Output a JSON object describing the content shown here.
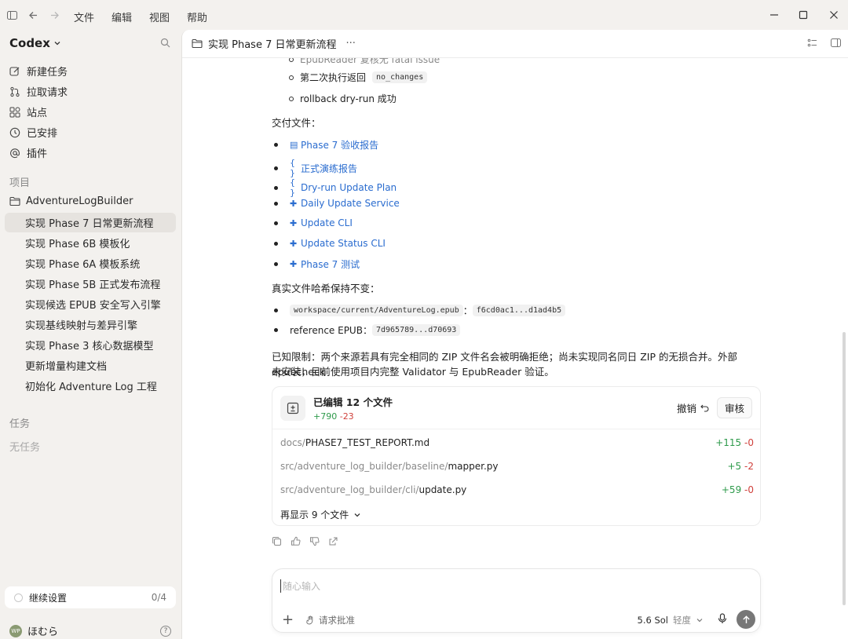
{
  "menu": {
    "items": [
      "文件",
      "编辑",
      "视图",
      "帮助"
    ]
  },
  "sidebar": {
    "brand": "Codex",
    "nav": [
      {
        "label": "新建任务",
        "icon": "edit-icon"
      },
      {
        "label": "拉取请求",
        "icon": "pull-request-icon"
      },
      {
        "label": "站点",
        "icon": "grid-icon"
      },
      {
        "label": "已安排",
        "icon": "clock-icon"
      },
      {
        "label": "插件",
        "icon": "at-icon"
      }
    ],
    "projects_label": "项目",
    "project_name": "AdventureLogBuilder",
    "threads": [
      "实现 Phase 7 日常更新流程",
      "实现 Phase 6B 模板化",
      "实现 Phase 6A 模板系统",
      "实现 Phase 5B 正式发布流程",
      "实现候选 EPUB 安全写入引擎",
      "实现基线映射与差异引擎",
      "实现 Phase 3 核心数据模型",
      "更新增量构建文档",
      "初始化 Adventure Log 工程"
    ],
    "tasks_label": "任务",
    "no_tasks": "无任务",
    "continue_label": "继续设置",
    "continue_count": "0/4",
    "user_name": "ほむら",
    "avatar_text": "WP"
  },
  "header": {
    "title": "实现 Phase 7 日常更新流程",
    "more": "···"
  },
  "content": {
    "partial_line": "EpubReader 复核无 fatal issue",
    "sub_bullets": [
      {
        "text": "第二次执行返回",
        "code": "no_changes"
      },
      {
        "text": "rollback dry-run 成功",
        "code": ""
      }
    ],
    "deliverables_label": "交付文件：",
    "links": [
      {
        "icon": "document-icon",
        "glyph": "▤",
        "label": "Phase 7 验收报告"
      },
      {
        "icon": "braces-icon",
        "glyph": "{ }",
        "label": "正式演练报告"
      },
      {
        "icon": "braces-icon",
        "glyph": "{ }",
        "label": "Dry-run Update Plan"
      },
      {
        "icon": "python-icon",
        "glyph": "✚",
        "label": "Daily Update Service"
      },
      {
        "icon": "python-icon",
        "glyph": "✚",
        "label": "Update CLI"
      },
      {
        "icon": "python-icon",
        "glyph": "✚",
        "label": "Update Status CLI"
      },
      {
        "icon": "python-icon",
        "glyph": "✚",
        "label": "Phase 7 测试"
      }
    ],
    "hash_label": "真实文件哈希保持不变：",
    "hashes": [
      {
        "left_code": "workspace/current/AdventureLog.epub",
        "sep": "：",
        "right_code": "f6cd0ac1...d1ad4b5"
      },
      {
        "left_text": "reference EPUB",
        "sep": "：",
        "right_code": "7d965789...d70693"
      }
    ],
    "limitation_line1": "已知限制：两个来源若具有完全相同的 ZIP 文件名会被明确拒绝；尚未实现同名同日 ZIP 的无损合并。外部 epubcheck",
    "limitation_line2": "未安装，目前使用项目内完整 Validator 与 EpubReader 验证。"
  },
  "edits": {
    "title": "已编辑 12 个文件",
    "added": "+790",
    "removed": "-23",
    "undo_label": "撤销",
    "review_label": "审核",
    "files": [
      {
        "dir": "docs/",
        "name": "PHASE7_TEST_REPORT.md",
        "added": "+115",
        "removed": "-0"
      },
      {
        "dir": "src/adventure_log_builder/baseline/",
        "name": "mapper.py",
        "added": "+5",
        "removed": "-2"
      },
      {
        "dir": "src/adventure_log_builder/cli/",
        "name": "update.py",
        "added": "+59",
        "removed": "-0"
      }
    ],
    "more_label": "再显示 9 个文件"
  },
  "composer": {
    "placeholder": "随心输入",
    "approve_label": "请求批准",
    "model_label": "5.6 Sol",
    "effort_label": "轻度"
  }
}
